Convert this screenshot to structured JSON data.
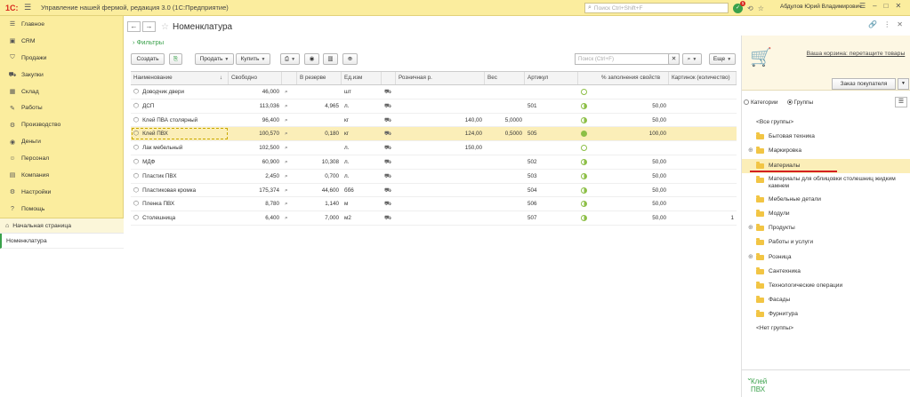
{
  "topbar": {
    "logo": "1С:",
    "app_title": "Управление нашей фермой, редакция 3.0 (1С:Предприятие)",
    "search_placeholder": "Поиск Ctrl+Shift+F",
    "notification_count": "1",
    "user": "Абдулов Юрий Владимирович"
  },
  "sidebar": {
    "items": [
      {
        "label": "Главное",
        "icon": "menu-icon"
      },
      {
        "label": "CRM",
        "icon": "crm-icon"
      },
      {
        "label": "Продажи",
        "icon": "sales-icon"
      },
      {
        "label": "Закупки",
        "icon": "purchases-icon"
      },
      {
        "label": "Склад",
        "icon": "warehouse-icon"
      },
      {
        "label": "Работы",
        "icon": "works-icon"
      },
      {
        "label": "Производство",
        "icon": "production-icon"
      },
      {
        "label": "Деньги",
        "icon": "money-icon"
      },
      {
        "label": "Персонал",
        "icon": "personnel-icon"
      },
      {
        "label": "Компания",
        "icon": "company-icon"
      },
      {
        "label": "Настройки",
        "icon": "settings-icon"
      },
      {
        "label": "Помощь",
        "icon": "help-icon"
      }
    ],
    "home_label": "Начальная страница",
    "open_item": "Номенклатура"
  },
  "main": {
    "title": "Номенклатура",
    "filters_label": "Фильтры",
    "toolbar": {
      "create": "Создать",
      "sell": "Продать",
      "buy": "Купить",
      "search_placeholder": "Поиск (Ctrl+F)",
      "more": "Еще"
    },
    "columns": [
      "Наименование",
      "Свободно",
      "В резерве",
      "Ед.изм",
      "Розничная р.",
      "Вес",
      "Артикул",
      "% заполнения свойств",
      "Картинок (количество)"
    ],
    "rows": [
      {
        "name": "Доводчик двери",
        "free": "46,000",
        "reserve": "",
        "unit": "шт",
        "price": "",
        "weight": "",
        "article": "",
        "fill": "",
        "pics": "",
        "pie": "empty"
      },
      {
        "name": "ДСП",
        "free": "113,036",
        "reserve": "4,965",
        "unit": "л.",
        "price": "",
        "weight": "",
        "article": "501",
        "fill": "50,00",
        "pics": "",
        "pie": "half"
      },
      {
        "name": "Клей ПВА столярный",
        "free": "96,400",
        "reserve": "",
        "unit": "кг",
        "price": "140,00",
        "weight": "5,0000",
        "article": "",
        "fill": "50,00",
        "pics": "",
        "pie": "half"
      },
      {
        "name": "Клей ПВХ",
        "free": "100,570",
        "reserve": "0,180",
        "unit": "кг",
        "price": "124,00",
        "weight": "0,5000",
        "article": "505",
        "fill": "100,00",
        "pics": "",
        "pie": "full",
        "selected": true
      },
      {
        "name": "Лак мебельный",
        "free": "102,500",
        "reserve": "",
        "unit": "л.",
        "price": "150,00",
        "weight": "",
        "article": "",
        "fill": "",
        "pics": "",
        "pie": "empty"
      },
      {
        "name": "МДФ",
        "free": "60,900",
        "reserve": "10,308",
        "unit": "л.",
        "price": "",
        "weight": "",
        "article": "502",
        "fill": "50,00",
        "pics": "",
        "pie": "half"
      },
      {
        "name": "Пластик ПВХ",
        "free": "2,450",
        "reserve": "0,700",
        "unit": "л.",
        "price": "",
        "weight": "",
        "article": "503",
        "fill": "50,00",
        "pics": "",
        "pie": "half"
      },
      {
        "name": "Пластиковая кромка",
        "free": "175,374",
        "reserve": "44,600",
        "unit": "бб6",
        "price": "",
        "weight": "",
        "article": "504",
        "fill": "50,00",
        "pics": "",
        "pie": "half"
      },
      {
        "name": "Пленка ПВХ",
        "free": "8,780",
        "reserve": "1,140",
        "unit": "м",
        "price": "",
        "weight": "",
        "article": "506",
        "fill": "50,00",
        "pics": "",
        "pie": "half"
      },
      {
        "name": "Столешница",
        "free": "6,400",
        "reserve": "7,000",
        "unit": "м2",
        "price": "",
        "weight": "",
        "article": "507",
        "fill": "50,00",
        "pics": "1",
        "pie": "half"
      }
    ]
  },
  "right_panel": {
    "cart_text": "Ваша корзина: перетащите товары",
    "order_button": "Заказ покупателя",
    "radio_categories": "Категории",
    "radio_groups": "Группы",
    "tree": [
      {
        "label": "<Все группы>",
        "type": "plain"
      },
      {
        "label": "Бытовая техника",
        "type": "folder"
      },
      {
        "label": "Маркировка",
        "type": "folder",
        "expand": "⊕"
      },
      {
        "label": "Материалы",
        "type": "folder",
        "selected": true
      },
      {
        "label": "Материалы для облицовки столешниц жидким камнем",
        "type": "folder",
        "multi": true
      },
      {
        "label": "Мебельные детали",
        "type": "folder"
      },
      {
        "label": "Модули",
        "type": "folder"
      },
      {
        "label": "Продукты",
        "type": "folder",
        "expand": "⊕"
      },
      {
        "label": "Работы и услуги",
        "type": "folder"
      },
      {
        "label": "Розница",
        "type": "folder",
        "expand": "⊕"
      },
      {
        "label": "Сантехника",
        "type": "folder"
      },
      {
        "label": "Технологические операции",
        "type": "folder"
      },
      {
        "label": "Фасады",
        "type": "folder"
      },
      {
        "label": "Фурнитура",
        "type": "folder"
      },
      {
        "label": "<Нет группы>",
        "type": "plain"
      }
    ],
    "selected_item": "Клей ПВХ"
  },
  "colors": {
    "accent_green": "#3aa14b",
    "panel_yellow": "#fbed9e",
    "selection": "#fbeeb8",
    "red_underline": "#d32020"
  }
}
